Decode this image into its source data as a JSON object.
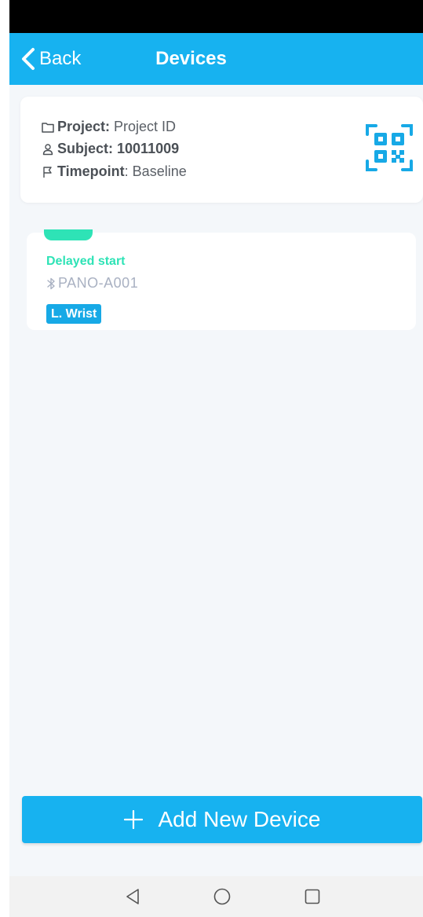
{
  "header": {
    "back_label": "Back",
    "title": "Devices"
  },
  "info": {
    "project_label": "Project:",
    "project_value": "Project ID",
    "subject_label": "Subject:",
    "subject_value": "10011009",
    "timepoint_label": "Timepoint",
    "timepoint_value": ": Baseline"
  },
  "devices": [
    {
      "status": "Delayed start",
      "status_color": "#2ee3b6",
      "device_id": "PANO-A001",
      "location": "L. Wrist"
    }
  ],
  "actions": {
    "add_label": "Add New Device"
  },
  "colors": {
    "accent": "#17b2f0",
    "badge": "#17a9e6",
    "status": "#2ee3b6",
    "background": "#f4f7fa"
  },
  "icons": {
    "back": "chevron-left-icon",
    "project": "folder-icon",
    "subject": "person-icon",
    "timepoint": "flag-icon",
    "qr": "qr-scan-icon",
    "bluetooth": "bluetooth-icon",
    "add": "plus-icon"
  }
}
